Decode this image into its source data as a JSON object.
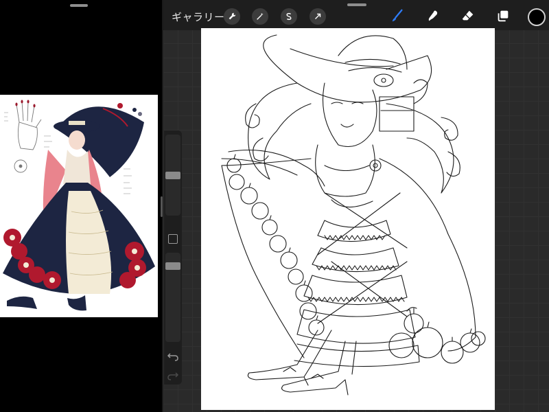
{
  "toolbar": {
    "gallery_label": "ギャラリー",
    "actions_icon": "wrench-icon",
    "adjustments_icon": "magic-wand-icon",
    "selection_icon": "selection-s-icon",
    "transform_icon": "arrow-cursor-icon",
    "brush_icon": "brush-icon",
    "smudge_icon": "smudge-icon",
    "eraser_icon": "eraser-icon",
    "layers_icon": "layers-icon",
    "current_color": "#000000"
  },
  "sidebar": {
    "brush_size_level": 0.5,
    "opacity_level": 0.88,
    "undo_icon": "undo-icon",
    "redo_icon": "redo-icon"
  },
  "colors": {
    "accent_brush": "#2f7cf6",
    "canvas_background": "#2a2a2a",
    "toolbar_background": "#1e1e1e"
  }
}
